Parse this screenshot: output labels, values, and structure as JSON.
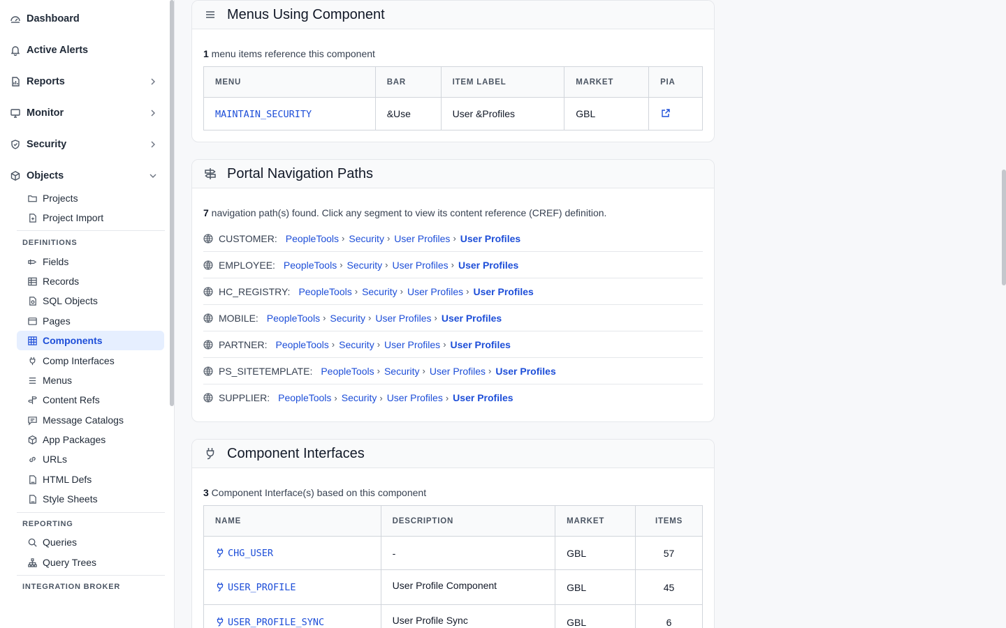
{
  "sidebar": {
    "top": [
      {
        "label": "Dashboard",
        "icon": "dashboard-icon"
      },
      {
        "label": "Active Alerts",
        "icon": "bell-icon"
      },
      {
        "label": "Reports",
        "icon": "report-icon"
      },
      {
        "label": "Monitor",
        "icon": "monitor-icon"
      },
      {
        "label": "Security",
        "icon": "shield-icon"
      },
      {
        "label": "Objects",
        "icon": "cube-icon"
      }
    ],
    "objects_items": [
      {
        "label": "Projects"
      },
      {
        "label": "Project Import"
      }
    ],
    "definitions_label": "DEFINITIONS",
    "definitions": [
      {
        "label": "Fields"
      },
      {
        "label": "Records"
      },
      {
        "label": "SQL Objects"
      },
      {
        "label": "Pages"
      },
      {
        "label": "Components"
      },
      {
        "label": "Comp Interfaces"
      },
      {
        "label": "Menus"
      },
      {
        "label": "Content Refs"
      },
      {
        "label": "Message Catalogs"
      },
      {
        "label": "App Packages"
      },
      {
        "label": "URLs"
      },
      {
        "label": "HTML Defs"
      },
      {
        "label": "Style Sheets"
      }
    ],
    "reporting_label": "REPORTING",
    "reporting": [
      {
        "label": "Queries"
      },
      {
        "label": "Query Trees"
      }
    ],
    "integration_label": "INTEGRATION BROKER"
  },
  "menus_card": {
    "title": "Menus Using Component",
    "summary_count": "1",
    "summary_text": " menu items reference this component",
    "headers": [
      "MENU",
      "BAR",
      "ITEM LABEL",
      "MARKET",
      "PIA"
    ],
    "rows": [
      {
        "menu": "MAINTAIN_SECURITY",
        "bar": "&Use",
        "item_label": "User &Profiles",
        "market": "GBL"
      }
    ]
  },
  "portal_card": {
    "title": "Portal Navigation Paths",
    "summary_count": "7",
    "summary_text": " navigation path(s) found. Click any segment to view its content reference (CREF) definition.",
    "paths": [
      {
        "portal": "CUSTOMER:",
        "segments": [
          "PeopleTools",
          "Security",
          "User Profiles"
        ],
        "final": "User Profiles"
      },
      {
        "portal": "EMPLOYEE:",
        "segments": [
          "PeopleTools",
          "Security",
          "User Profiles"
        ],
        "final": "User Profiles"
      },
      {
        "portal": "HC_REGISTRY:",
        "segments": [
          "PeopleTools",
          "Security",
          "User Profiles"
        ],
        "final": "User Profiles"
      },
      {
        "portal": "MOBILE:",
        "segments": [
          "PeopleTools",
          "Security",
          "User Profiles"
        ],
        "final": "User Profiles"
      },
      {
        "portal": "PARTNER:",
        "segments": [
          "PeopleTools",
          "Security",
          "User Profiles"
        ],
        "final": "User Profiles"
      },
      {
        "portal": "PS_SITETEMPLATE:",
        "segments": [
          "PeopleTools",
          "Security",
          "User Profiles"
        ],
        "final": "User Profiles"
      },
      {
        "portal": "SUPPLIER:",
        "segments": [
          "PeopleTools",
          "Security",
          "User Profiles"
        ],
        "final": "User Profiles"
      }
    ],
    "separator": "›"
  },
  "ci_card": {
    "title": "Component Interfaces",
    "summary_count": "3",
    "summary_text": " Component Interface(s) based on this component",
    "headers": [
      "NAME",
      "DESCRIPTION",
      "MARKET",
      "ITEMS"
    ],
    "rows": [
      {
        "name": "CHG_USER",
        "description": "-",
        "market": "GBL",
        "items": "57"
      },
      {
        "name": "USER_PROFILE",
        "description": "User Profile Component",
        "market": "GBL",
        "items": "45"
      },
      {
        "name": "USER_PROFILE_SYNC",
        "description": "User Profile Sync",
        "market": "GBL",
        "items": "6"
      }
    ]
  },
  "colors": {
    "accent": "#1d4ed8",
    "active_bg": "#e6efff"
  }
}
